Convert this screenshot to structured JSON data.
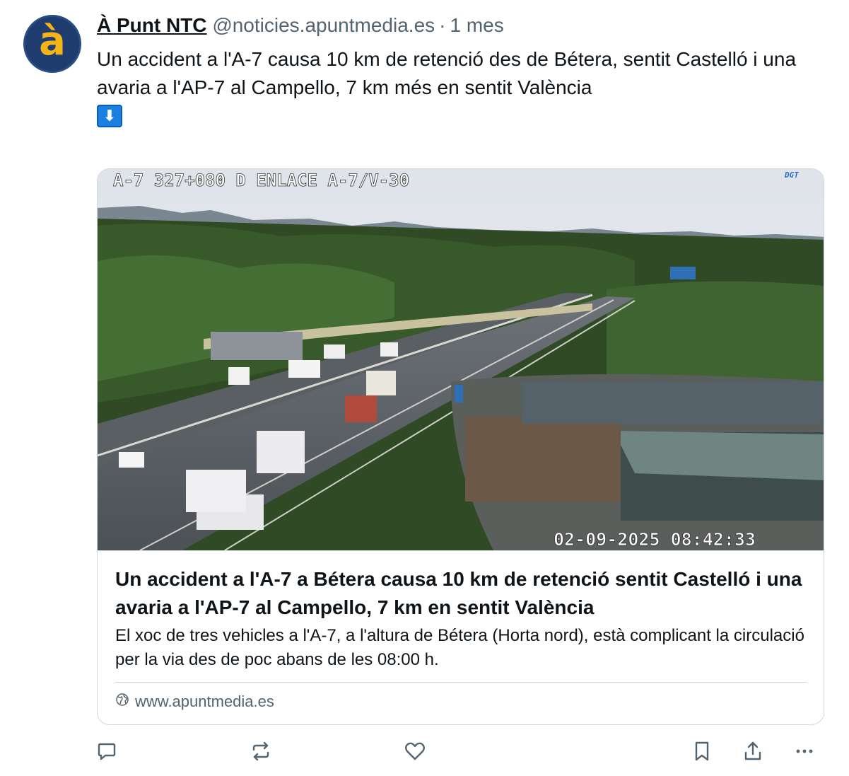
{
  "post": {
    "avatar_glyph": "à",
    "author_name": "À Punt NTC",
    "author_handle": "@noticies.apuntmedia.es",
    "separator": "·",
    "timestamp": "1 mes",
    "text": "Un accident a l'A-7 causa 10 km de retenció des de Bétera, sentit Castelló i una avaria a l'AP-7 al Campello, 7 km més en sentit València",
    "emoji": "⬇"
  },
  "card": {
    "image": {
      "overlay_top": "A-7 327+080 D ENLACE A-7/V-30",
      "brand": "DGT",
      "overlay_bottom": "02-09-2025 08:42:33"
    },
    "title": "Un accident a l'A-7 a Bétera causa 10 km de retenció sentit Castelló i una avaria a l'AP-7 al Campello, 7 km en sentit València",
    "description": "El xoc de tres vehicles a l'A-7, a l'altura de Bétera (Horta nord), està complicant la circulació per la via des de poc abans de les 08:00 h.",
    "domain": "www.apuntmedia.es"
  },
  "actions": [
    {
      "name": "reply",
      "icon": "speech-bubble-icon"
    },
    {
      "name": "repost",
      "icon": "repost-icon"
    },
    {
      "name": "like",
      "icon": "heart-icon"
    },
    {
      "name": "bookmark",
      "icon": "bookmark-icon"
    },
    {
      "name": "share",
      "icon": "share-icon"
    },
    {
      "name": "more",
      "icon": "ellipsis-icon"
    }
  ],
  "colors": {
    "text": "#0f1419",
    "muted": "#536471",
    "border": "#cfd9de",
    "avatar_bg": "#1f3c6e",
    "avatar_glyph": "#f2b417"
  }
}
